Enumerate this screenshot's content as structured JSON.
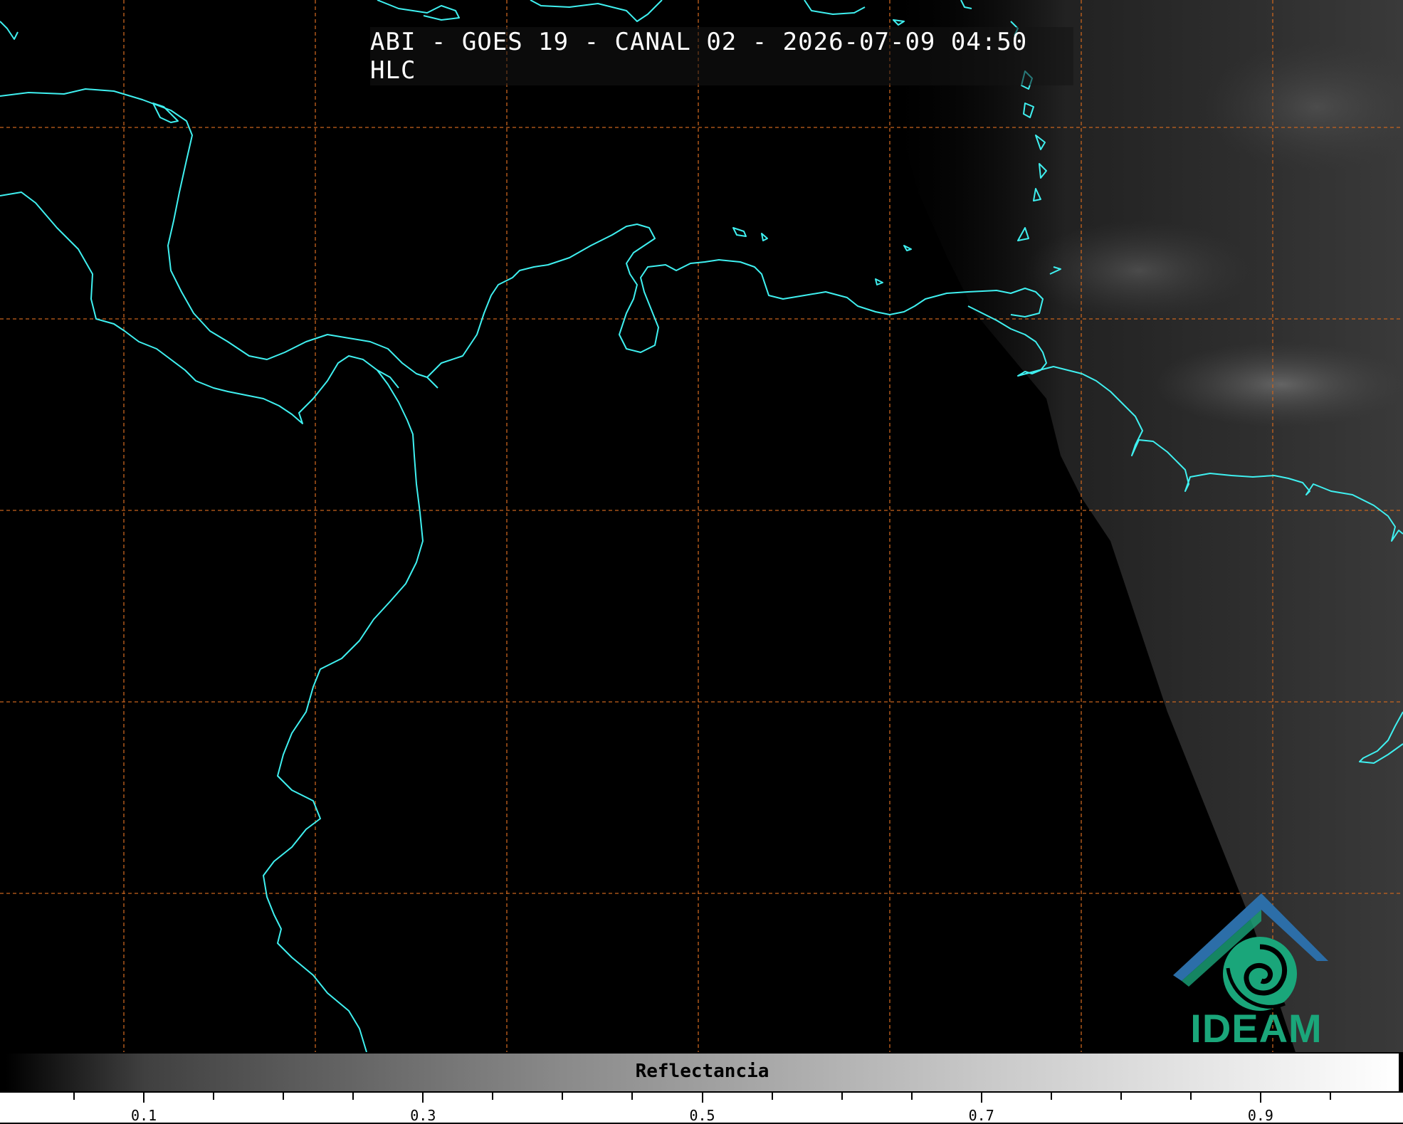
{
  "title": "ABI - GOES 19 - CANAL 02 - 2026-07-09 04:50 HLC",
  "colorbar": {
    "label": "Reflectancia",
    "ticks": [
      "0.1",
      "0.3",
      "0.5",
      "0.7",
      "0.9"
    ],
    "range": [
      0.0,
      1.0
    ],
    "colormap": "grayscale"
  },
  "logo": {
    "text": "IDEAM",
    "colors": {
      "roof": "#2c6ea8",
      "swirl": "#1aa67a"
    }
  },
  "colors": {
    "coastline": "#3ff0f0",
    "gridlines": "#c8641e",
    "background": "#000000"
  }
}
